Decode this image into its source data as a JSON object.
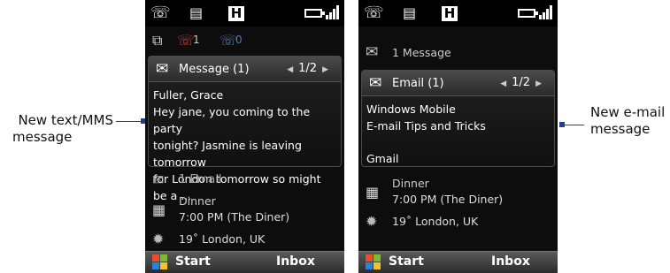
{
  "callouts": {
    "left": [
      "New text/MMS",
      "message"
    ],
    "right": [
      "New e-mail",
      "message"
    ]
  },
  "colors": {
    "callout": "#1f3f86",
    "dim_text": "#a8a8a8"
  },
  "screen1": {
    "status_counts": {
      "missed_calls": "1",
      "voicemail": "0"
    },
    "message_card": {
      "title": "Message (1)",
      "pager": "1/2",
      "sender": "Fuller, Grace",
      "lines": [
        "Hey jane, you coming to the party",
        "tonight? Jasmine is leaving tomorrow",
        "for London tomorrow so might be a ..."
      ]
    },
    "email_row": "1 Email",
    "appointment": {
      "title": "Dinner",
      "detail": "7:00 PM (The Diner)"
    },
    "weather": "19˚ London, UK",
    "softkeys": {
      "left": "Start",
      "right": "Inbox"
    }
  },
  "screen2": {
    "message_row": "1 Message",
    "email_card": {
      "title": "Email (1)",
      "pager": "1/2",
      "lines": [
        "Windows Mobile",
        "E-mail Tips and Tricks"
      ],
      "account": "Gmail"
    },
    "appointment": {
      "title": "Dinner",
      "detail": "7:00 PM (The Diner)"
    },
    "weather": "19˚ London, UK",
    "softkeys": {
      "left": "Start",
      "right": "Inbox"
    }
  }
}
